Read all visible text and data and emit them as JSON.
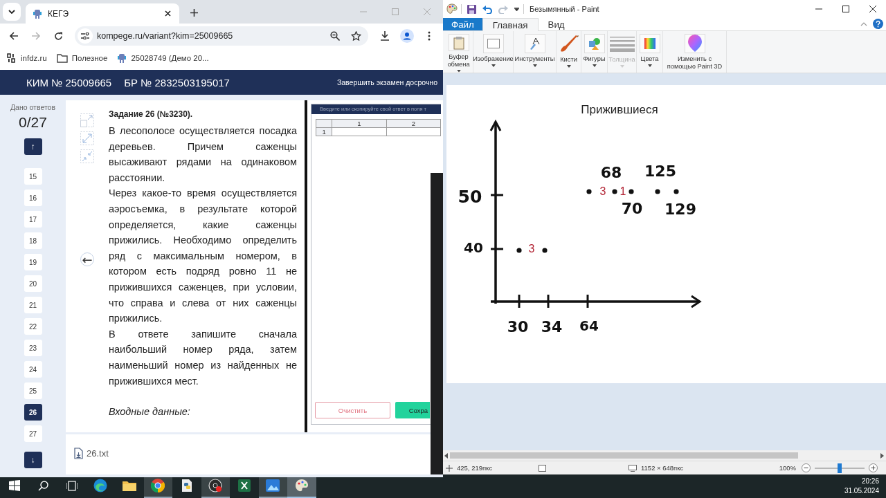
{
  "browser": {
    "tab_title": "КЕГЭ",
    "url": "kompege.ru/variant?kim=25009665",
    "forward_disabled": true,
    "bookmarks": [
      {
        "label": "infdz.ru",
        "kind": "site"
      },
      {
        "label": "Полезное",
        "kind": "folder"
      },
      {
        "label": "25028749 (Демо 20...",
        "kind": "page"
      }
    ]
  },
  "exam": {
    "kim": "КИМ № 25009665",
    "br": "БР № 2832503195017",
    "finish": "Завершить экзамен досрочно",
    "answers_label": "Дано ответов",
    "answers_count": "0/27",
    "up": "↑",
    "down": "↓",
    "tasks": [
      {
        "label": "15",
        "selected": false
      },
      {
        "label": "16",
        "selected": false
      },
      {
        "label": "17",
        "selected": false
      },
      {
        "label": "18",
        "selected": false
      },
      {
        "label": "19",
        "selected": false
      },
      {
        "label": "20",
        "selected": false
      },
      {
        "label": "21",
        "selected": false
      },
      {
        "label": "22",
        "selected": false
      },
      {
        "label": "23",
        "selected": false
      },
      {
        "label": "24",
        "selected": false
      },
      {
        "label": "25",
        "selected": false
      },
      {
        "label": "26",
        "selected": true
      },
      {
        "label": "27",
        "selected": false
      }
    ],
    "back": "←",
    "task_title": "Задание 26 (№3230).",
    "paragraphs": [
      "В лесополосе осуществляется посадка деревьев. Причем саженцы высаживают рядами на одинаковом расстоянии.",
      "Через какое-то время осуществляется аэросъемка, в результате которой определяется, какие саженцы прижились. Необходимо определить ряд с максимальным номером, в котором есть подряд ровно 11 не прижившихся саженцев, при условии, что справа и слева от них саженцы прижились.",
      "В ответе запишите сначала наибольший номер ряда, затем наименьший номер из найденных не прижившихся мест."
    ],
    "input_heading": "Входные данные:",
    "answer_hint": "Введите или скопируйте свой ответ в поля т",
    "answer_table": {
      "columns": [
        "1",
        "2"
      ],
      "rows": [
        "1"
      ]
    },
    "clear": "Очистить",
    "save": "Сохра",
    "file": "26.txt"
  },
  "paint": {
    "title": "Безымянный - Paint",
    "redo_disabled": true,
    "tabs": [
      {
        "label": "Файл",
        "kind": "file",
        "selected": false
      },
      {
        "label": "Главная",
        "kind": "tab",
        "selected": true
      },
      {
        "label": "Вид",
        "kind": "tab",
        "selected": false
      }
    ],
    "groups": [
      {
        "label": "Буфер обмена",
        "kind": "dropdown",
        "disabled": false
      },
      {
        "label": "Изображение",
        "kind": "dropdown",
        "disabled": false
      },
      {
        "label": "Инструменты",
        "kind": "dropdown",
        "disabled": false
      },
      {
        "label": "Кисти",
        "kind": "dropdown",
        "disabled": false
      },
      {
        "label": "Фигуры",
        "kind": "dropdown",
        "disabled": false
      },
      {
        "label": "Толщина",
        "kind": "dropdown",
        "disabled": true
      },
      {
        "label": "Цвета",
        "kind": "dropdown",
        "disabled": false
      },
      {
        "label": "Изменить с помощью Paint 3D",
        "kind": "button",
        "disabled": false
      }
    ],
    "sketch": {
      "title": "Прижившиеся",
      "y_labels": [
        "50",
        "40"
      ],
      "x_labels": [
        "30",
        "34",
        "64"
      ],
      "point_labels": [
        "68",
        "125",
        "70",
        "129"
      ],
      "gap_counts": [
        "3",
        "1",
        "3"
      ]
    },
    "status": {
      "cursor": "425, 219пкс",
      "size": "1152 × 648пкс",
      "zoom": "100%",
      "zoom_slider": {
        "level": 0.5
      }
    }
  },
  "taskbar": {
    "apps": [
      {
        "kind": "start",
        "active": false,
        "focused": false
      },
      {
        "kind": "search",
        "active": false,
        "focused": false
      },
      {
        "kind": "taskview",
        "active": false,
        "focused": false
      },
      {
        "kind": "edge",
        "active": false,
        "focused": false
      },
      {
        "kind": "explorer",
        "active": false,
        "focused": false
      },
      {
        "kind": "chrome",
        "active": true,
        "focused": false
      },
      {
        "kind": "python",
        "active": false,
        "focused": false
      },
      {
        "kind": "recorder",
        "active": true,
        "focused": false
      },
      {
        "kind": "excel",
        "active": false,
        "focused": false
      },
      {
        "kind": "photos",
        "active": true,
        "focused": false
      },
      {
        "kind": "paint",
        "active": true,
        "focused": true
      }
    ],
    "time": "20:26",
    "date": "31.05.2024"
  }
}
